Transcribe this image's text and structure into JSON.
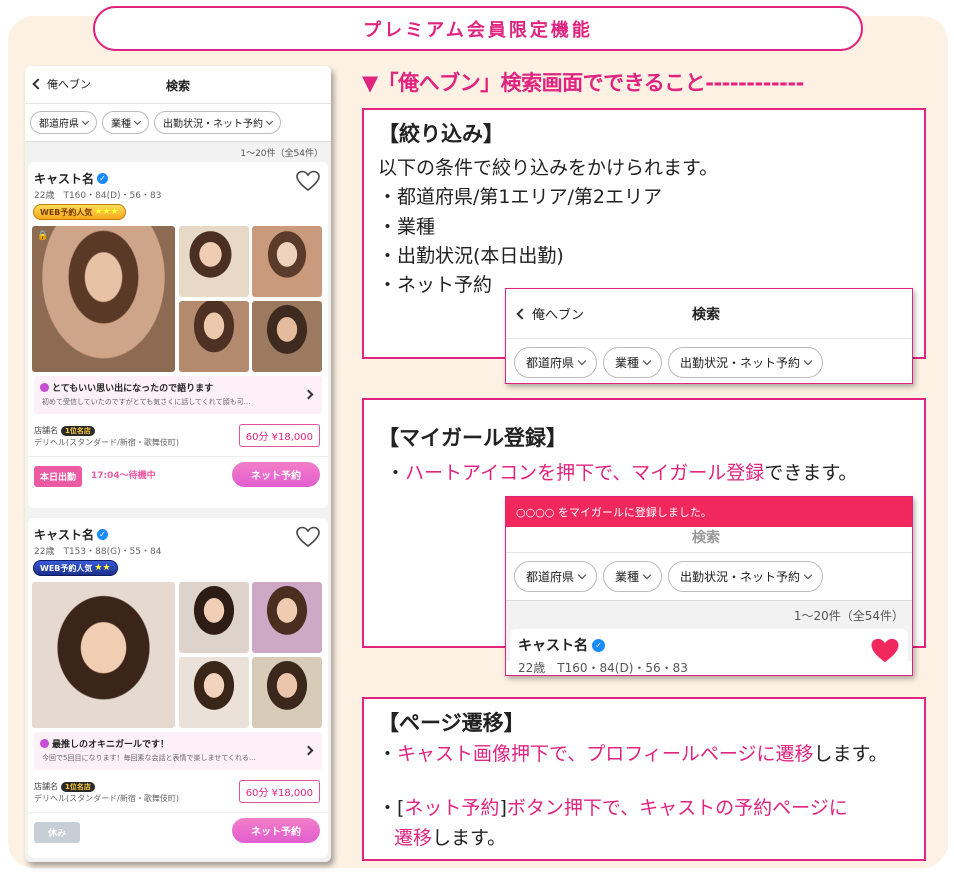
{
  "banner": "プレミアム会員限定機能",
  "heading": "▼「俺へブン」検索画面でできること------------",
  "phone": {
    "back": "俺へブン",
    "title": "検索",
    "chips": [
      "都道府県",
      "業種",
      "出勤状況・ネット予約"
    ],
    "count": "1～20件（全54件）",
    "cards": [
      {
        "name": "キャスト名",
        "stats": "22歳　T160・84(D)・56・83",
        "badge": "WEB予約人気",
        "badge_stars": "★★★",
        "msg_title": "とてもいい思い出になったので語ります",
        "msg_body": "初めて受信していたのですがとても気さくに話してくれて顔も可…",
        "shop_label": "店舗名",
        "shop_pill": "1位名店",
        "shop_type": "デリヘル(スタンダード/新宿・歌舞伎町)",
        "price": "60分 ¥18,000",
        "status": "本日出勤",
        "wait": "17:04～待機中",
        "reserve": "ネット予約"
      },
      {
        "name": "キャスト名",
        "stats": "22歳　T153・88(G)・55・84",
        "badge": "WEB予約人気",
        "badge_stars": "★★",
        "msg_title": "最推しのオキニガールです！",
        "msg_body": "今回で5回目になります！毎回素な会話と表情で楽しませてくれる…",
        "shop_label": "店舗名",
        "shop_pill": "1位名店",
        "shop_type": "デリヘル(スタンダード/新宿・歌舞伎町)",
        "price": "60分 ¥18,000",
        "status": "休み",
        "reserve": "ネット予約"
      }
    ]
  },
  "filter_box": {
    "title": "【絞り込み】",
    "intro": "以下の条件で絞り込みをかけられます。",
    "items": [
      "・都道府県/第1エリア/第2エリア",
      "・業種",
      "・出勤状況(本日出勤)",
      "・ネット予約"
    ]
  },
  "mygirl_box": {
    "title": "【マイガール登録】",
    "line_prefix": "・",
    "line_pink": "ハートアイコンを押下で、マイガール登録",
    "line_suffix": "できます。",
    "toast": "○○○○ をマイガールに登録しました。",
    "count": "1～20件（全54件）",
    "name": "キャスト名",
    "stats": "22歳　T160・84(D)・56・83"
  },
  "page_box": {
    "title": "【ページ遷移】",
    "l1_prefix": "・",
    "l1_pink": "キャスト画像押下で、プロフィールページに遷移",
    "l1_suffix": "します。",
    "l2_prefix": "・[",
    "l2_pink1": "ネット予約",
    "l2_mid": "]",
    "l2_pink2": "ボタン押下で、キャストの予約ページに",
    "l3_pink": "遷移",
    "l3_suffix": "します。"
  },
  "colors": {
    "accent": "#e0247f",
    "panel": "#fdf1e3",
    "toast": "#f0285e",
    "heart": "#f0285e"
  }
}
